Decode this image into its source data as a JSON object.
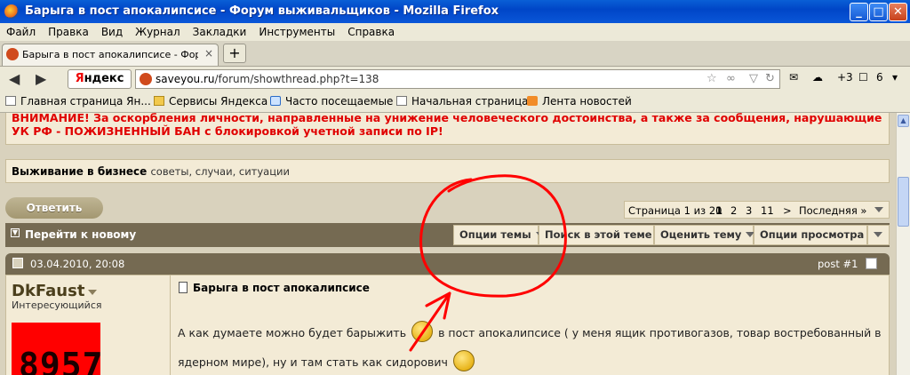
{
  "window": {
    "title": "Барыга в пост апокалипсисе - Форум выживальщиков - Mozilla Firefox",
    "controls": {
      "minimize": "_",
      "maximize": "□",
      "close": "✕"
    }
  },
  "menu": [
    "Файл",
    "Правка",
    "Вид",
    "Журнал",
    "Закладки",
    "Инструменты",
    "Справка"
  ],
  "tab": {
    "label": "Барыга в пост апокалипсисе - Форум выж...",
    "close": "×",
    "new_tab": "+"
  },
  "nav": {
    "back": "◀",
    "forward": "▶",
    "search_engine_prefix": "Я",
    "search_engine_rest": "ндекс",
    "url_host": "saveyou.ru",
    "url_path": "/forum/showthread.php?t=138",
    "weather": "+3",
    "counter": "6"
  },
  "bookmarks": [
    "Главная страница Ян...",
    "Сервисы Яндекса",
    "Часто посещаемые",
    "Начальная страница",
    "Лента новостей"
  ],
  "forum": {
    "warning": "ВНИМАНИЕ! За оскорбления личности, направленные на унижение человеческого достоинства, а также за сообщения, нарушающие УК РФ - ПОЖИЗНЕННЫЙ БАН с блокировкой учетной записи по IP!",
    "section_name": "Выживание в бизнесе",
    "section_desc": "советы, случаи, ситуации",
    "reply_button": "Ответить",
    "pager": {
      "label": "Страница 1 из 20",
      "current": "1",
      "pages": [
        "2",
        "3",
        "11"
      ],
      "next": ">",
      "last": "Последняя »"
    },
    "toolbar": {
      "goto_new": "Перейти к новому",
      "options": [
        "Опции темы",
        "Поиск в этой теме",
        "Оценить тему",
        "Опции просмотра"
      ]
    },
    "post": {
      "date": "03.04.2010, 20:08",
      "number": "post #1",
      "username": "DkFaust",
      "user_title": "Интересующийся",
      "avatar_text": "8957",
      "title": "Барыга в пост апокалипсисе",
      "text_part1": "А как думаете можно будет барыжить",
      "text_part2": "в пост апокалипсисе ( у меня ящик противогазов, товар востребованный в ядерном мире), ну и там стать как сидорович"
    }
  },
  "colors": {
    "titlebar": "#0a56d8",
    "warning": "#e00000",
    "forum_dark": "#756a52",
    "annotation": "#ff0000"
  }
}
